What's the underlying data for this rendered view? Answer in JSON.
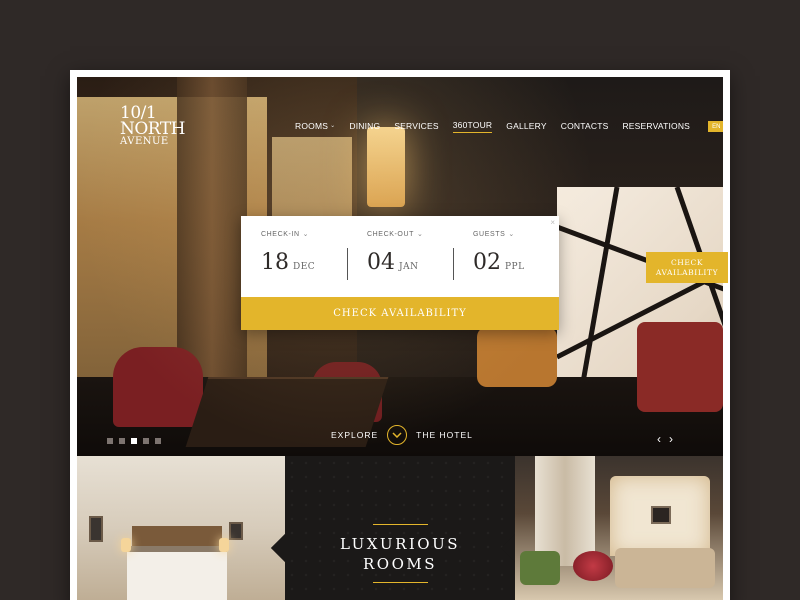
{
  "brand": {
    "line1": "10/1",
    "line2": "NORTH",
    "line3": "AVENUE"
  },
  "nav": {
    "items": [
      {
        "label": "ROOMS",
        "has_dropdown": true
      },
      {
        "label": "DINING"
      },
      {
        "label": "SERVICES"
      },
      {
        "label": "360TOUR",
        "active": true
      },
      {
        "label": "GALLERY"
      },
      {
        "label": "CONTACTS"
      },
      {
        "label": "RESERVATIONS"
      }
    ],
    "language": "EN"
  },
  "booking": {
    "checkin": {
      "label": "CHECK-IN",
      "day": "18",
      "unit": "DEC"
    },
    "checkout": {
      "label": "CHECK-OUT",
      "day": "04",
      "unit": "JAN"
    },
    "guests": {
      "label": "GUESTS",
      "count": "02",
      "unit": "PPL"
    },
    "button": "CHECK AVAILABILITY",
    "close": "×"
  },
  "side_tab": {
    "line1": "CHECK",
    "line2": "AVAILABILITY"
  },
  "slider": {
    "dot_count": 5,
    "active_index": 2,
    "explore_left": "EXPLORE",
    "explore_right": "THE HOTEL",
    "prev": "‹",
    "next": "›"
  },
  "rooms_section": {
    "title_line1": "LUXURIOUS",
    "title_line2": "ROOMS"
  },
  "colors": {
    "accent": "#e3b52b",
    "background": "#2f2927",
    "dark_panel": "#1b1918"
  },
  "icons": {
    "dropdown": "chevron-down-icon",
    "explore": "chevron-down-circle-icon",
    "close": "close-icon",
    "prev": "arrow-left-icon",
    "next": "arrow-right-icon"
  }
}
